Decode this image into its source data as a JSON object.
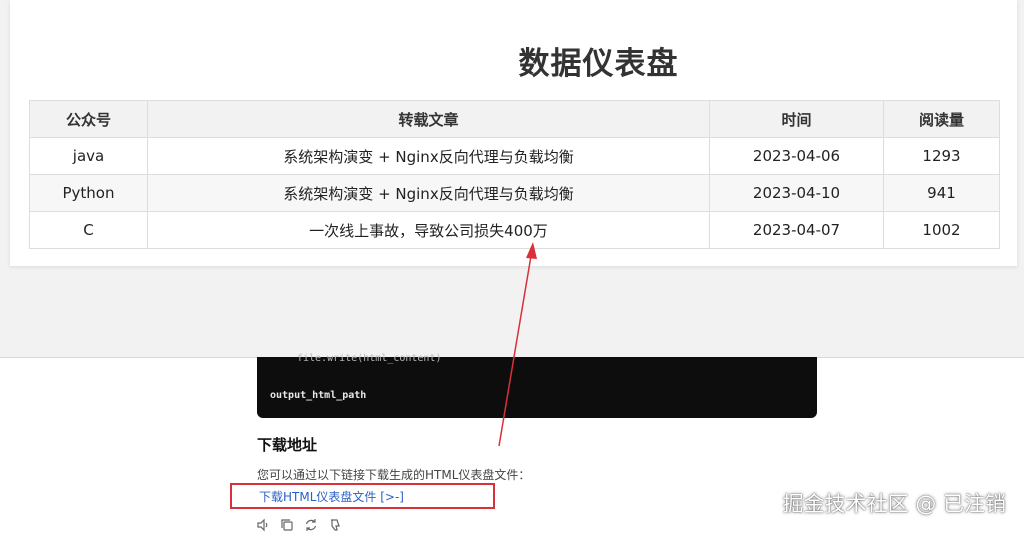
{
  "dashboard": {
    "title": "数据仪表盘",
    "columns": [
      "公众号",
      "转载文章",
      "时间",
      "阅读量"
    ],
    "rows": [
      [
        "java",
        "系统架构演变 + Nginx反向代理与负载均衡",
        "2023-04-06",
        "1293"
      ],
      [
        "Python",
        "系统架构演变 + Nginx反向代理与负载均衡",
        "2023-04-10",
        "941"
      ],
      [
        "C",
        "一次线上事故，导致公司损失400万",
        "2023-04-07",
        "1002"
      ]
    ]
  },
  "chat": {
    "code_line_1": "file.write(html_content)",
    "code_line_2": "output_html_path",
    "heading": "下载地址",
    "description": "您可以通过以下链接下载生成的HTML仪表盘文件：",
    "link_text": "下载HTML仪表盘文件 [>-]",
    "actions": [
      "speaker-icon",
      "copy-icon",
      "regenerate-icon",
      "thumbs-down-icon"
    ]
  },
  "watermark": "掘金技术社区 @ 已注销",
  "colors": {
    "highlight_red": "#d9303a",
    "link_blue": "#2b62c8",
    "code_bg": "#0d0d0d"
  }
}
